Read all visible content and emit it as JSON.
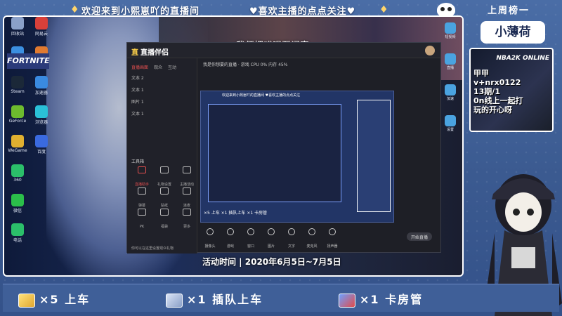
{
  "overlay": {
    "welcome_text": "欢迎来到小熙崽吖的直播间",
    "follow_text": "♥喜欢主播的点点关注♥",
    "last_week_label": "上周榜一",
    "last_week_name": "小薄荷"
  },
  "stream": {
    "subtitle": "我便把戏唱至词穷",
    "activity_text": "活动时间 | 2020年6月5日~7月5日",
    "fortnite_label": "FORTNITE"
  },
  "desktop_icons": [
    {
      "label": "回收站",
      "color": "#8aa0c8"
    },
    {
      "label": "QQ",
      "color": "#3b8fe0"
    },
    {
      "label": "Steam",
      "color": "#1b2838"
    },
    {
      "label": "GeForce",
      "color": "#6dbb2e"
    },
    {
      "label": "WeGame",
      "color": "#e0b030"
    },
    {
      "label": "360",
      "color": "#2bbf6a"
    },
    {
      "label": "微信",
      "color": "#2bbf4a"
    },
    {
      "label": "电话",
      "color": "#2bbf6a"
    }
  ],
  "desktop_icons2": [
    {
      "label": "网易云",
      "color": "#d8403a"
    },
    {
      "label": "腾讯",
      "color": "#e07a30"
    },
    {
      "label": "加速器",
      "color": "#3a8ae0"
    },
    {
      "label": "浏览器",
      "color": "#2ac0d8"
    },
    {
      "label": "百度",
      "color": "#3a6ae0"
    }
  ],
  "app": {
    "logo_mark": "直",
    "logo_name": "直播伴侣",
    "side_tabs": [
      "直播画面",
      "观众",
      "互动"
    ],
    "scenes": [
      "文本 2",
      "文本 1",
      "图片 1",
      "文本 1"
    ],
    "tools_title": "工具箱",
    "tools": [
      {
        "label": "直播助手",
        "hot": true
      },
      {
        "label": "礼物设置",
        "hot": false
      },
      {
        "label": "主播活动",
        "hot": false
      },
      {
        "label": "弹幕",
        "hot": false
      },
      {
        "label": "贴纸",
        "hot": false
      },
      {
        "label": "连麦",
        "hot": false
      },
      {
        "label": "PK",
        "hot": false
      },
      {
        "label": "福袋",
        "hot": false
      },
      {
        "label": "更多",
        "hot": false
      }
    ],
    "header_text": "我是你想要的直播 · 游戏  CPU 0% 内存 45%",
    "preview_banner": "欢迎来到小熙崽吖的直播间 ♥喜欢主播的点点关注",
    "preview_gift": "×5 上车    ×1 插队上车    ×1 卡房管",
    "controls": [
      "摄像头",
      "游戏",
      "窗口",
      "图片",
      "文字",
      "麦克风",
      "扬声器"
    ],
    "start_label": "开始直播",
    "notice": "你可以在这里设置观众礼物"
  },
  "right_panel": {
    "mini_icons": [
      {
        "label": "短视频"
      },
      {
        "label": "直播"
      },
      {
        "label": "加速"
      },
      {
        "label": "设置"
      }
    ],
    "promo_text": "甲甲\nv+nrx0122\n13期/1\n0n线上一起打\n玩的开心呀",
    "promo_nba": "NBA2K ONLINE"
  },
  "gifts": [
    {
      "label": "×5 上车"
    },
    {
      "label": "×1 插队上车"
    },
    {
      "label": "×1 卡房管"
    }
  ]
}
